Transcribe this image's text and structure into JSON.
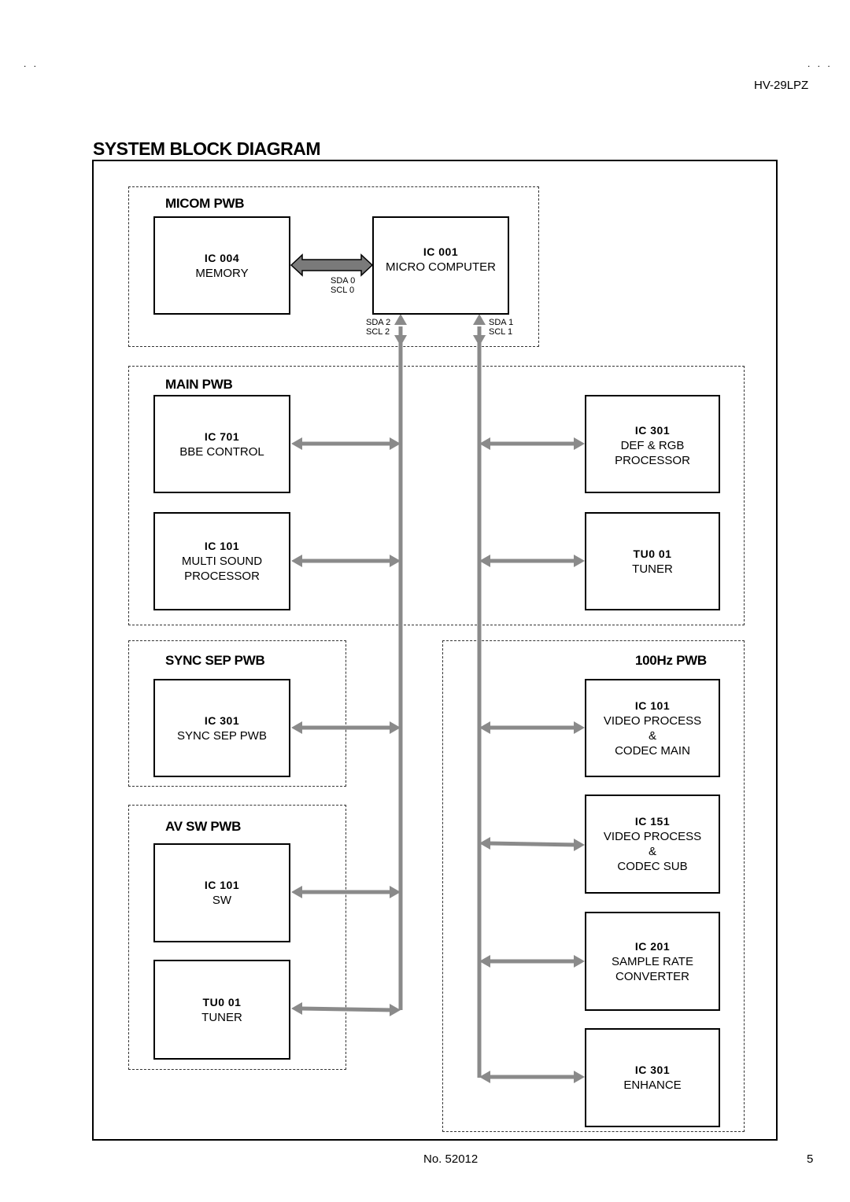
{
  "header": {
    "left_marks": ". .",
    "right_marks": ". . .",
    "model": "HV-29LPZ",
    "title": "SYSTEM BLOCK DIAGRAM"
  },
  "pwbs": {
    "micom": {
      "label": "MICOM PWB",
      "chips": [
        {
          "id": "IC 004",
          "function": [
            "MEMORY"
          ]
        },
        {
          "id": "IC 001",
          "function": [
            "MICRO COMPUTER"
          ]
        }
      ],
      "signals": {
        "bus0": [
          "SDA 0",
          "SCL 0"
        ],
        "bus2": [
          "SDA 2",
          "SCL 2"
        ],
        "bus1": [
          "SDA 1",
          "SCL 1"
        ]
      }
    },
    "main": {
      "label": "MAIN PWB",
      "chips": [
        {
          "id": "IC 701",
          "function": [
            "BBE CONTROL"
          ],
          "bus": "SDA2/SCL2"
        },
        {
          "id": "IC 101",
          "function": [
            "MULTI SOUND",
            "PROCESSOR"
          ],
          "bus": "SDA2/SCL2"
        },
        {
          "id": "IC 301",
          "function": [
            "DEF & RGB",
            "PROCESSOR"
          ],
          "bus": "SDA1/SCL1"
        },
        {
          "id": "TU0 01",
          "function": [
            "TUNER"
          ],
          "bus": "SDA1/SCL1"
        }
      ]
    },
    "sync_sep": {
      "label": "SYNC SEP PWB",
      "chips": [
        {
          "id": "IC 301",
          "function": [
            "SYNC SEP PWB"
          ],
          "bus": "SDA2/SCL2"
        }
      ]
    },
    "av_sw": {
      "label": "AV SW PWB",
      "chips": [
        {
          "id": "IC 101",
          "function": [
            "SW"
          ],
          "bus": "SDA2/SCL2"
        },
        {
          "id": "TU0 01",
          "function": [
            "TUNER"
          ],
          "bus": "SDA2/SCL2"
        }
      ]
    },
    "hz100": {
      "label": "100Hz PWB",
      "chips": [
        {
          "id": "IC 101",
          "function": [
            "VIDEO PROCESS",
            "&",
            "CODEC MAIN"
          ],
          "bus": "SDA1/SCL1"
        },
        {
          "id": "IC 151",
          "function": [
            "VIDEO PROCESS",
            "&",
            "CODEC SUB"
          ],
          "bus": "SDA1/SCL1"
        },
        {
          "id": "IC 201",
          "function": [
            "SAMPLE RATE",
            "CONVERTER"
          ],
          "bus": "SDA1/SCL1"
        },
        {
          "id": "IC 301",
          "function": [
            "ENHANCE"
          ],
          "bus": "SDA1/SCL1"
        }
      ]
    }
  },
  "colors": {
    "bus": "#8a8a8a",
    "bus0_fill": "#7a7a7a",
    "border": "#000000"
  },
  "footer": {
    "doc_no": "No. 52012",
    "page": "5"
  }
}
